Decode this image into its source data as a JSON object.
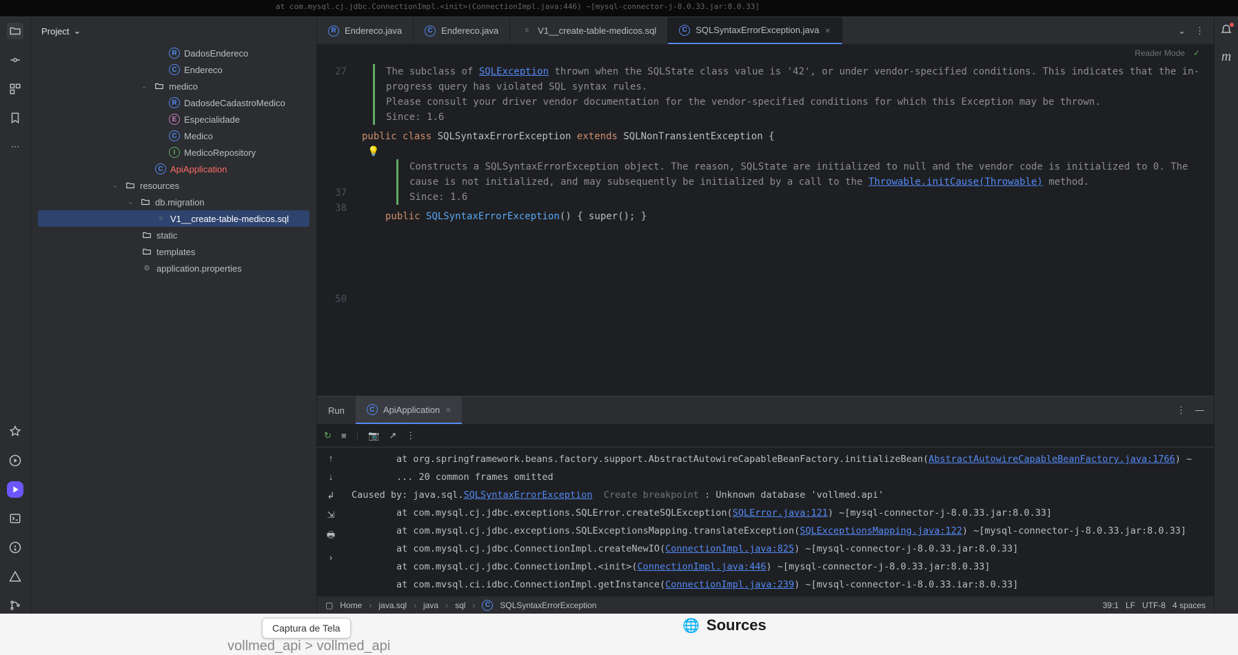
{
  "bg_trace": "at com.mysql.cj.jdbc.ConnectionImpl.<init>(ConnectionImpl.java:446) ~[mysql-connector-j-8.0.33.jar:8.0.33]",
  "project_label": "Project",
  "tree": {
    "t0": "DadosEndereco",
    "t1": "Endereco",
    "t2": "medico",
    "t3": "DadosdeCadastroMedico",
    "t4": "Especialidade",
    "t5": "Medico",
    "t6": "MedicoRepository",
    "t7": "ApiApplication",
    "t8": "resources",
    "t9": "db.migration",
    "t10": "V1__create-table-medicos.sql",
    "t11": "static",
    "t12": "templates",
    "t13": "application.properties"
  },
  "tabs": {
    "tab0": "Endereco.java",
    "tab1": "Endereco.java",
    "tab2": "V1__create-table-medicos.sql",
    "tab3": "SQLSyntaxErrorException.java"
  },
  "reader_mode": "Reader Mode",
  "doc": {
    "line1a": "The subclass of ",
    "line1code": "SQLException",
    "line1b": " thrown when the SQLState class value is '42', or under vendor-specified conditions. This indicates that the in-progress query has violated SQL syntax rules.",
    "line2": "Please consult your driver vendor documentation for the vendor-specified conditions for which this ",
    "line2code": "Exception",
    "line2b": " may be thrown.",
    "since1": "Since: 1.6",
    "inner1a": "Constructs a ",
    "inner1code": "SQLSyntaxErrorException",
    "inner1b": " object. The ",
    "inner1reason": "reason",
    "inner1c": ", ",
    "inner1state": "SQLState",
    "inner1d": " are initialized to ",
    "inner1null": "null",
    "inner1e": " and the vendor code is initialized to 0. The ",
    "inner1cause": "cause",
    "inner1f": " is not initialized, and may subsequently be initialized by a call to the ",
    "inner1throw": "Throwable.initCause(Throwable)",
    "inner1g": " method.",
    "since2": "Since: 1.6"
  },
  "lines": {
    "l27": "27",
    "l37": "37",
    "l38": "38",
    "l50": "50"
  },
  "code": {
    "pub": "public",
    "cls": "class",
    "name": "SQLSyntaxErrorException",
    "ext": "extends",
    "parent": "SQLNonTransientException",
    "ob": "{",
    "ctor_pub": "public",
    "ctor_name": "SQLSyntaxErrorException",
    "ctor_par": "()",
    "ctor_body": "{ super(); }"
  },
  "run": {
    "label": "Run",
    "config": "ApiApplication"
  },
  "console": {
    "l1a": "        at org.springframework.beans.factory.support.AbstractAutowireCapableBeanFactory.initializeBean(",
    "l1link": "AbstractAutowireCapableBeanFactory.java:1766",
    "l1b": ") ~",
    "l2": "        ... 20 common frames omitted",
    "l3a": "Caused by: java.sql.",
    "l3link": "SQLSyntaxErrorException",
    "l3hint": "Create breakpoint",
    "l3b": " : Unknown database 'vollmed.api'",
    "l4a": "        at com.mysql.cj.jdbc.exceptions.SQLError.createSQLException(",
    "l4link": "SQLError.java:121",
    "l4b": ") ~[mysql-connector-j-8.0.33.jar:8.0.33]",
    "l5a": "        at com.mysql.cj.jdbc.exceptions.SQLExceptionsMapping.translateException(",
    "l5link": "SQLExceptionsMapping.java:122",
    "l5b": ") ~[mysql-connector-j-8.0.33.jar:8.0.33]",
    "l6a": "        at com.mysql.cj.jdbc.ConnectionImpl.createNewIO(",
    "l6link": "ConnectionImpl.java:825",
    "l6b": ") ~[mysql-connector-j-8.0.33.jar:8.0.33]",
    "l7a": "        at com.mysql.cj.jdbc.ConnectionImpl.<init>(",
    "l7link": "ConnectionImpl.java:446",
    "l7b": ") ~[mysql-connector-j-8.0.33.jar:8.0.33]",
    "l8a": "        at com.mvsql.ci.idbc.ConnectionImpl.getInstance(",
    "l8link": "ConnectionImpl.java:239",
    "l8b": ") ~[mvsql-connector-i-8.0.33.iar:8.0.33]"
  },
  "status": {
    "home": "Home",
    "c1": "java.sql",
    "c2": "java",
    "c3": "sql",
    "c4": "SQLSyntaxErrorException",
    "pos": "39:1",
    "lf": "LF",
    "enc": "UTF-8",
    "indent": "4 spaces"
  },
  "tooltip": "Captura de Tela",
  "sources": "Sources",
  "crumb": "vollmed_api > vollmed_api"
}
